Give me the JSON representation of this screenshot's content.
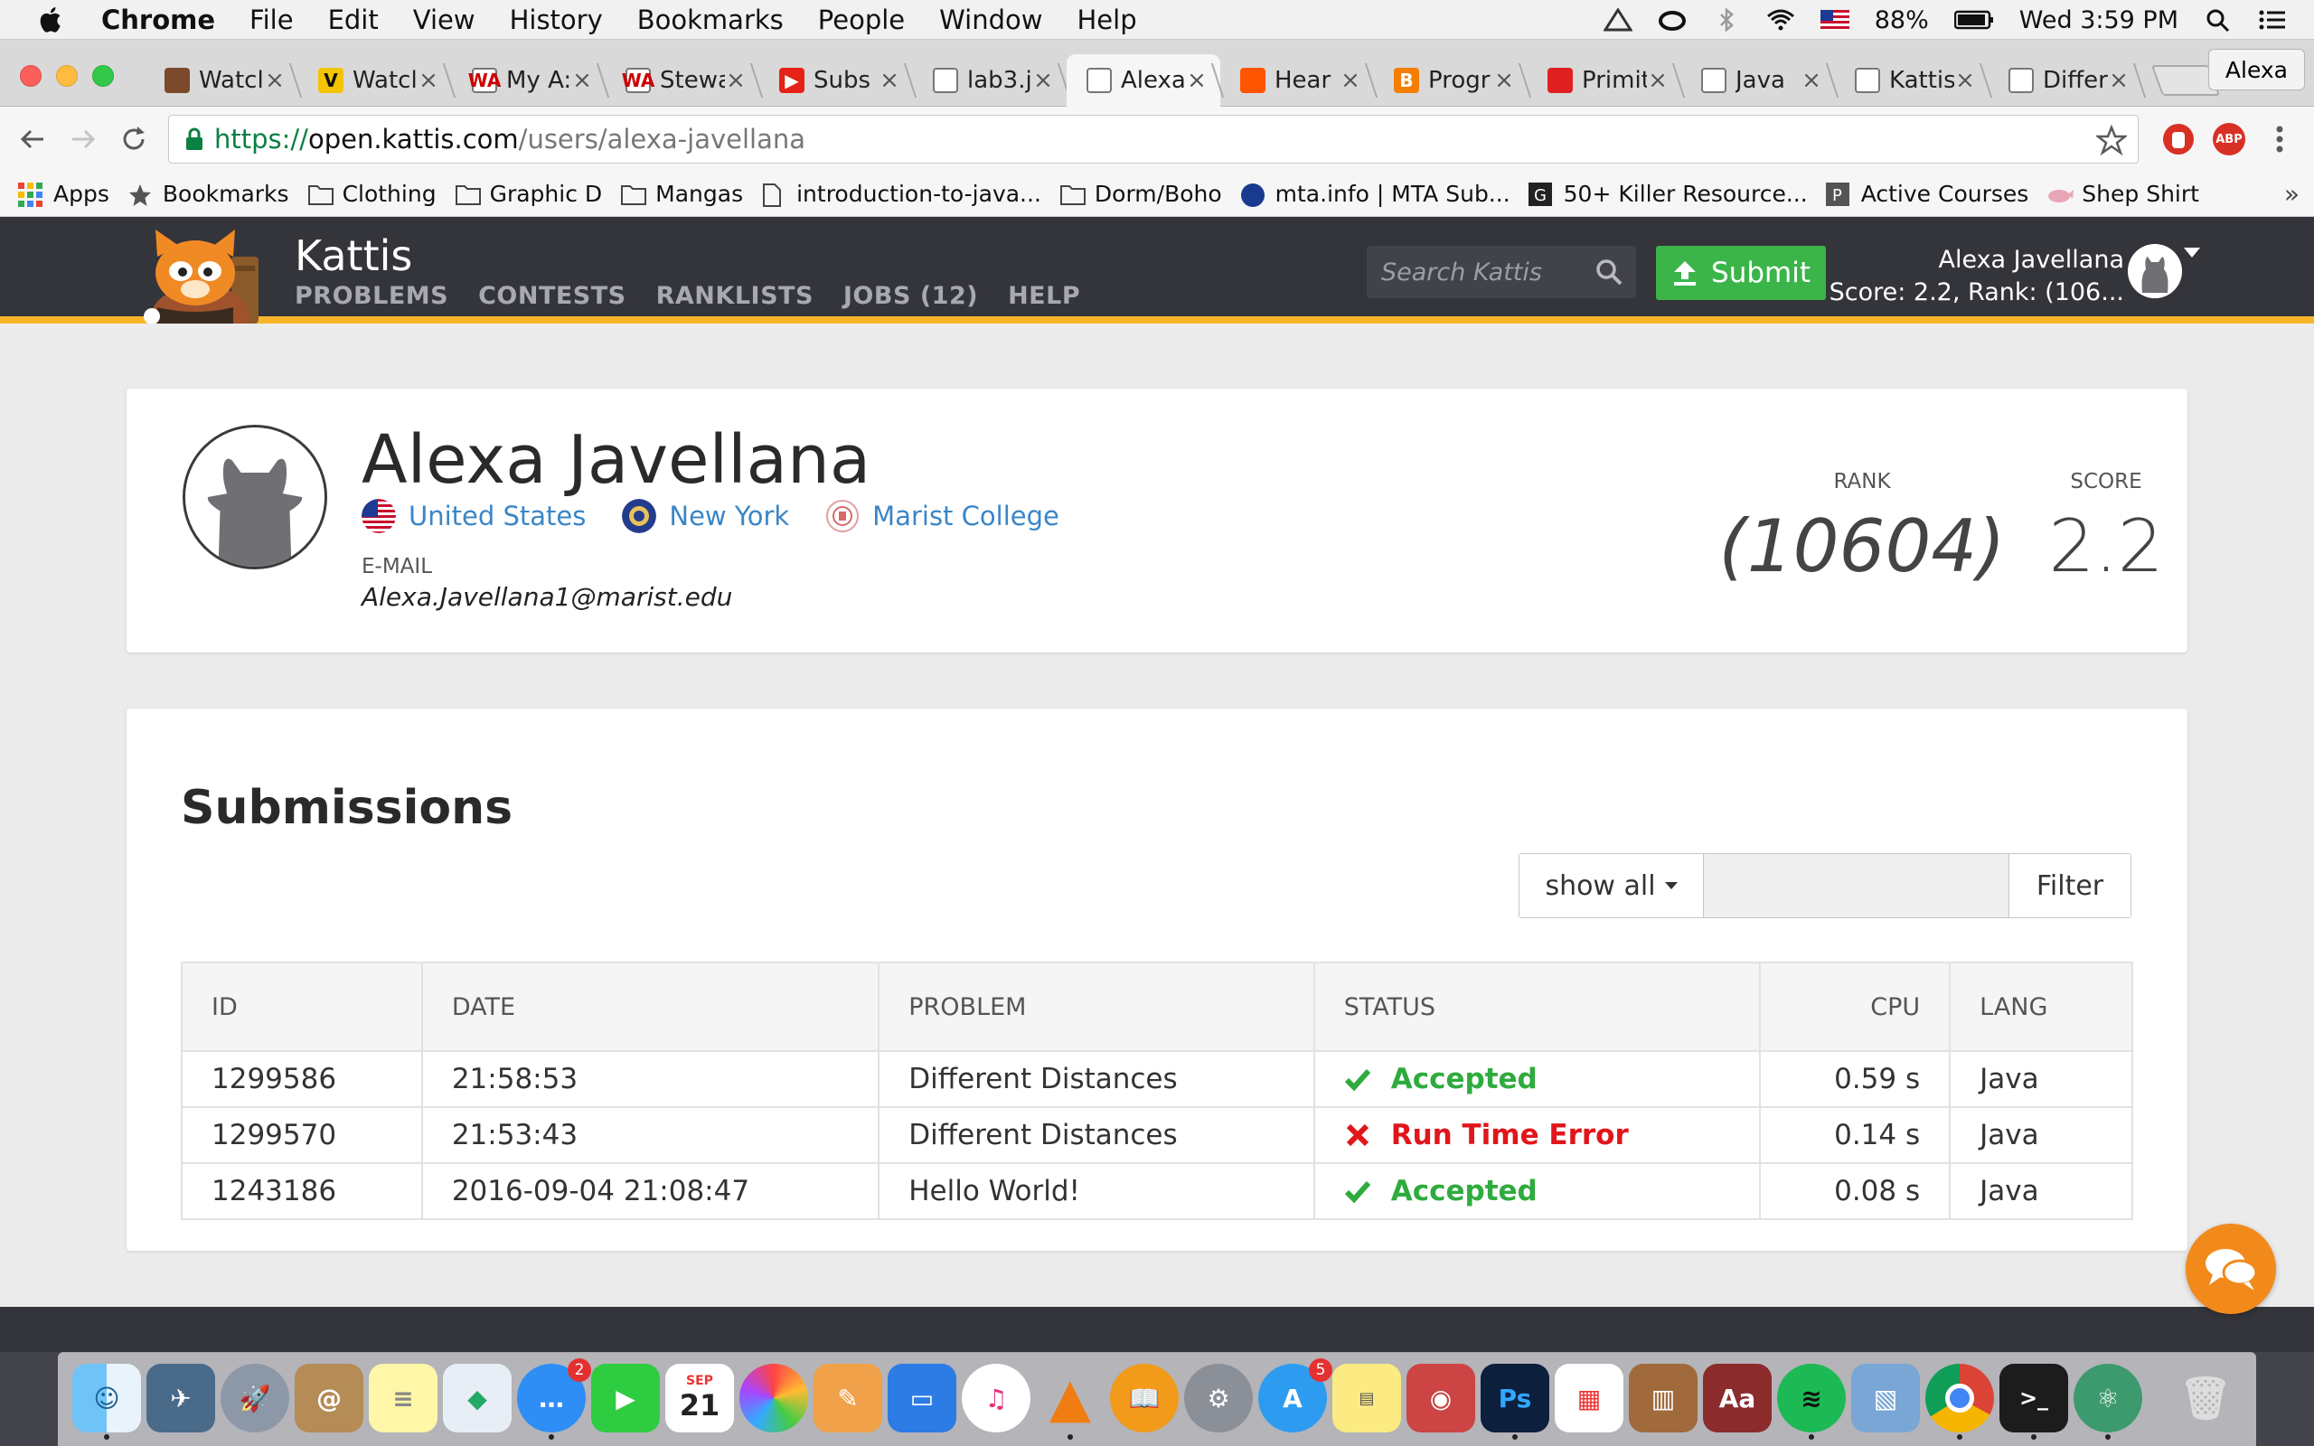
{
  "menubar": {
    "app_name": "Chrome",
    "items": [
      "File",
      "Edit",
      "View",
      "History",
      "Bookmarks",
      "People",
      "Window",
      "Help"
    ],
    "battery": "88%",
    "clock": "Wed 3:59 PM"
  },
  "browser": {
    "tabs": [
      {
        "label": "Watcl",
        "fav_color": "#7a4a2a",
        "fav_text": ""
      },
      {
        "label": "Watcl",
        "fav_color": "#f5c400",
        "fav_text": "V"
      },
      {
        "label": "My A:",
        "fav_color": "#ffffff",
        "fav_text": "WA"
      },
      {
        "label": "Stewa",
        "fav_color": "#ffffff",
        "fav_text": "WA"
      },
      {
        "label": "Subs",
        "fav_color": "#e62117",
        "fav_text": "▶"
      },
      {
        "label": "lab3.j",
        "fav_color": "#ffffff",
        "fav_text": ""
      },
      {
        "label": "Alexa",
        "fav_color": "#ffffff",
        "fav_text": ""
      },
      {
        "label": "Hear",
        "fav_color": "#ff5500",
        "fav_text": ""
      },
      {
        "label": "Progr",
        "fav_color": "#f57d00",
        "fav_text": "B"
      },
      {
        "label": "Primit",
        "fav_color": "#e02020",
        "fav_text": ""
      },
      {
        "label": "Java",
        "fav_color": "#ffffff",
        "fav_text": ""
      },
      {
        "label": "Kattis",
        "fav_color": "#ffffff",
        "fav_text": ""
      },
      {
        "label": "Differ",
        "fav_color": "#ffffff",
        "fav_text": ""
      }
    ],
    "active_tab_index": 6,
    "profile": "Alexa",
    "url_scheme": "https://",
    "url_host": "open.kattis.com",
    "url_path": "/users/alexa-javellana"
  },
  "bookmarks": [
    {
      "label": "Apps",
      "icon": "apps-grid-icon"
    },
    {
      "label": "Bookmarks",
      "icon": "star-icon"
    },
    {
      "label": "Clothing",
      "icon": "folder-icon"
    },
    {
      "label": "Graphic D",
      "icon": "folder-icon"
    },
    {
      "label": "Mangas",
      "icon": "folder-icon"
    },
    {
      "label": "introduction-to-java...",
      "icon": "page-icon"
    },
    {
      "label": "Dorm/Boho",
      "icon": "folder-icon"
    },
    {
      "label": "mta.info | MTA Sub...",
      "icon": "mta-icon"
    },
    {
      "label": "50+ Killer Resource...",
      "icon": "g-icon"
    },
    {
      "label": "Active Courses",
      "icon": "p-icon"
    },
    {
      "label": "Shep Shirt",
      "icon": "whale-icon"
    }
  ],
  "kattis": {
    "brand": "Kattis",
    "nav": [
      "PROBLEMS",
      "CONTESTS",
      "RANKLISTS",
      "JOBS (12)",
      "HELP"
    ],
    "search_placeholder": "Search Kattis",
    "submit_label": "Submit",
    "user_name": "Alexa Javellana",
    "user_summary": "Score: 2.2, Rank: (106..."
  },
  "profile": {
    "name": "Alexa Javellana",
    "country": "United States",
    "region": "New York",
    "school": "Marist College",
    "email_label": "E-MAIL",
    "email": "Alexa.Javellana1@marist.edu",
    "rank_label": "RANK",
    "rank": "(10604)",
    "score_label": "SCORE",
    "score": "2.2"
  },
  "submissions": {
    "title": "Submissions",
    "filter_select": "show all",
    "filter_button": "Filter",
    "columns": [
      "ID",
      "DATE",
      "PROBLEM",
      "STATUS",
      "CPU",
      "LANG"
    ],
    "rows": [
      {
        "id": "1299586",
        "date": "21:58:53",
        "problem": "Different Distances",
        "status": "Accepted",
        "status_type": "ok",
        "cpu": "0.59 s",
        "lang": "Java"
      },
      {
        "id": "1299570",
        "date": "21:53:43",
        "problem": "Different Distances",
        "status": "Run Time Error",
        "status_type": "error",
        "cpu": "0.14 s",
        "lang": "Java"
      },
      {
        "id": "1243186",
        "date": "2016-09-04 21:08:47",
        "problem": "Hello World!",
        "status": "Accepted",
        "status_type": "ok",
        "cpu": "0.08 s",
        "lang": "Java"
      }
    ]
  },
  "colors": {
    "accepted": "#2fab3e",
    "error": "#e0161b",
    "link": "#3b86c6",
    "header_bg": "#34343b",
    "header_accent": "#f7b529"
  },
  "dock": {
    "messages_badge": "2",
    "appstore_badge": "5",
    "calendar_month": "SEP",
    "calendar_day": "21",
    "photoshop_label": "Ps",
    "dictionary_label": "Aa"
  }
}
